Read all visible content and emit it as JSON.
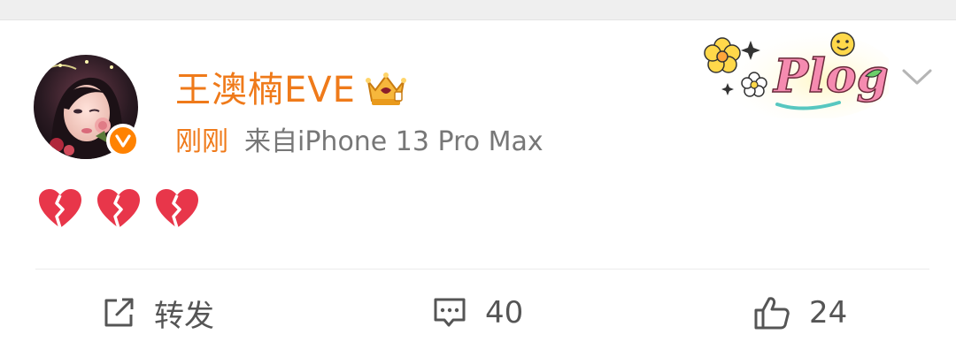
{
  "post": {
    "author": {
      "name": "王澳楠EVE",
      "verified": true,
      "avatar_icon": "avatar-photo",
      "badge_icon": "crown-badge-icon"
    },
    "meta": {
      "time": "刚刚",
      "source": "来自iPhone 13 Pro Max"
    },
    "decoration": {
      "sticker_text": "Plog",
      "sticker_icon": "plog-sticker"
    },
    "content": {
      "emojis": [
        "💔",
        "💔",
        "💔"
      ]
    },
    "actions": {
      "repost_label": "转发",
      "comment_count": "40",
      "like_count": "24"
    }
  },
  "colors": {
    "accent": "#ef7a1a",
    "verified": "#ff8200",
    "text_secondary": "#777777",
    "action_text": "#555555",
    "heart": "#e8364a"
  }
}
